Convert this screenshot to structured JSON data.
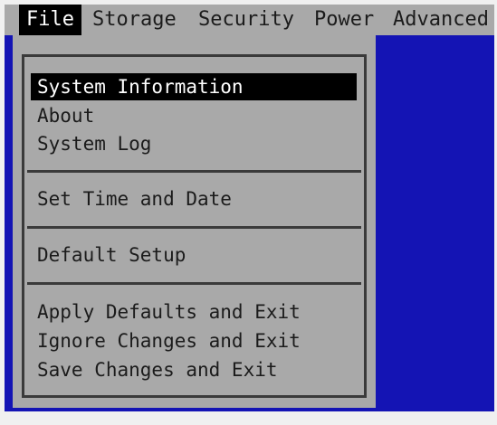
{
  "colors": {
    "background": "#1414b4",
    "panel": "#a9a9a9",
    "highlight": "#000000",
    "highlight_text": "#ffffff",
    "text": "#1b1b1b"
  },
  "menubar": {
    "items": [
      {
        "label": "File",
        "active": true
      },
      {
        "label": "Storage"
      },
      {
        "label": "Security"
      },
      {
        "label": "Power"
      },
      {
        "label": "Advanced"
      }
    ]
  },
  "file_menu": {
    "groups": [
      {
        "items": [
          {
            "label": "System Information",
            "selected": true
          },
          {
            "label": "About"
          },
          {
            "label": "System Log"
          }
        ]
      },
      {
        "items": [
          {
            "label": "Set Time and Date"
          }
        ]
      },
      {
        "items": [
          {
            "label": "Default Setup"
          }
        ]
      },
      {
        "items": [
          {
            "label": "Apply Defaults and Exit"
          },
          {
            "label": "Ignore Changes and Exit"
          },
          {
            "label": "Save Changes and Exit"
          }
        ]
      }
    ]
  }
}
